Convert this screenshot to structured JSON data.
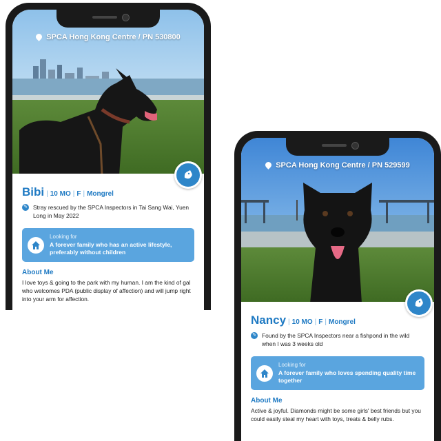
{
  "profiles": [
    {
      "location": "SPCA Hong Kong Centre / PN 530800",
      "name": "Bibi",
      "age": "10 MO",
      "sex": "F",
      "breed": "Mongrel",
      "rescue": "Stray rescued by the SPCA Inspectors in Tai Sang Wai, Yuen Long in May 2022",
      "looking_label": "Looking for",
      "looking_text": "A forever family who has an active lifestyle, preferably without children",
      "about_heading": "About Me",
      "about_text": "I love toys & going to the park with my human. I am the kind of gal who welcomes PDA (public display of affection) and will jump right into your arm for affection."
    },
    {
      "location": "SPCA Hong Kong Centre / PN 529599",
      "name": "Nancy",
      "age": "10 MO",
      "sex": "F",
      "breed": "Mongrel",
      "rescue": "Found by the SPCA Inspectors near a fishpond in the wild when I was 3 weeks old",
      "looking_label": "Looking for",
      "looking_text": "A forever family who loves spending quality time together",
      "about_heading": "About Me",
      "about_text": "Active & joyful. Diamonds might be some girls' best friends but you could easily steal my heart with toys, treats & belly rubs."
    }
  ],
  "colors": {
    "accent": "#1f7ac3",
    "panel": "#5aa5df",
    "badge": "#2e86c9"
  },
  "icons": [
    "location-pin-icon",
    "dog-badge-icon",
    "rescue-info-icon",
    "house-icon"
  ]
}
